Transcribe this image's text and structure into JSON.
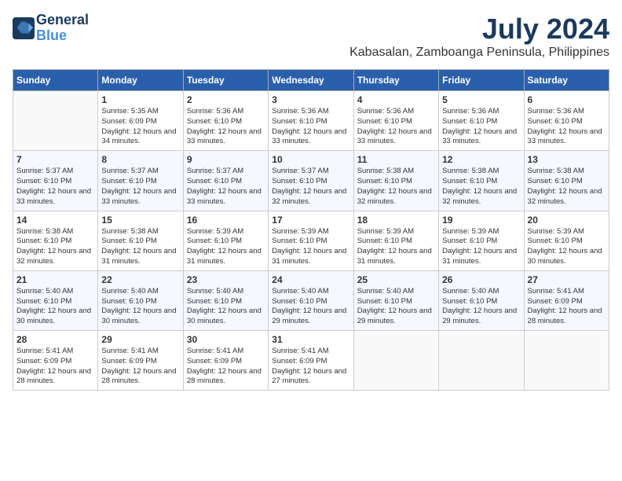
{
  "logo": {
    "line1": "General",
    "line2": "Blue"
  },
  "title": "July 2024",
  "location": "Kabasalan, Zamboanga Peninsula, Philippines",
  "weekdays": [
    "Sunday",
    "Monday",
    "Tuesday",
    "Wednesday",
    "Thursday",
    "Friday",
    "Saturday"
  ],
  "weeks": [
    [
      {
        "day": "",
        "sunrise": "",
        "sunset": "",
        "daylight": ""
      },
      {
        "day": "1",
        "sunrise": "Sunrise: 5:35 AM",
        "sunset": "Sunset: 6:09 PM",
        "daylight": "Daylight: 12 hours and 34 minutes."
      },
      {
        "day": "2",
        "sunrise": "Sunrise: 5:36 AM",
        "sunset": "Sunset: 6:10 PM",
        "daylight": "Daylight: 12 hours and 33 minutes."
      },
      {
        "day": "3",
        "sunrise": "Sunrise: 5:36 AM",
        "sunset": "Sunset: 6:10 PM",
        "daylight": "Daylight: 12 hours and 33 minutes."
      },
      {
        "day": "4",
        "sunrise": "Sunrise: 5:36 AM",
        "sunset": "Sunset: 6:10 PM",
        "daylight": "Daylight: 12 hours and 33 minutes."
      },
      {
        "day": "5",
        "sunrise": "Sunrise: 5:36 AM",
        "sunset": "Sunset: 6:10 PM",
        "daylight": "Daylight: 12 hours and 33 minutes."
      },
      {
        "day": "6",
        "sunrise": "Sunrise: 5:36 AM",
        "sunset": "Sunset: 6:10 PM",
        "daylight": "Daylight: 12 hours and 33 minutes."
      }
    ],
    [
      {
        "day": "7",
        "sunrise": "Sunrise: 5:37 AM",
        "sunset": "Sunset: 6:10 PM",
        "daylight": "Daylight: 12 hours and 33 minutes."
      },
      {
        "day": "8",
        "sunrise": "Sunrise: 5:37 AM",
        "sunset": "Sunset: 6:10 PM",
        "daylight": "Daylight: 12 hours and 33 minutes."
      },
      {
        "day": "9",
        "sunrise": "Sunrise: 5:37 AM",
        "sunset": "Sunset: 6:10 PM",
        "daylight": "Daylight: 12 hours and 33 minutes."
      },
      {
        "day": "10",
        "sunrise": "Sunrise: 5:37 AM",
        "sunset": "Sunset: 6:10 PM",
        "daylight": "Daylight: 12 hours and 32 minutes."
      },
      {
        "day": "11",
        "sunrise": "Sunrise: 5:38 AM",
        "sunset": "Sunset: 6:10 PM",
        "daylight": "Daylight: 12 hours and 32 minutes."
      },
      {
        "day": "12",
        "sunrise": "Sunrise: 5:38 AM",
        "sunset": "Sunset: 6:10 PM",
        "daylight": "Daylight: 12 hours and 32 minutes."
      },
      {
        "day": "13",
        "sunrise": "Sunrise: 5:38 AM",
        "sunset": "Sunset: 6:10 PM",
        "daylight": "Daylight: 12 hours and 32 minutes."
      }
    ],
    [
      {
        "day": "14",
        "sunrise": "Sunrise: 5:38 AM",
        "sunset": "Sunset: 6:10 PM",
        "daylight": "Daylight: 12 hours and 32 minutes."
      },
      {
        "day": "15",
        "sunrise": "Sunrise: 5:38 AM",
        "sunset": "Sunset: 6:10 PM",
        "daylight": "Daylight: 12 hours and 31 minutes."
      },
      {
        "day": "16",
        "sunrise": "Sunrise: 5:39 AM",
        "sunset": "Sunset: 6:10 PM",
        "daylight": "Daylight: 12 hours and 31 minutes."
      },
      {
        "day": "17",
        "sunrise": "Sunrise: 5:39 AM",
        "sunset": "Sunset: 6:10 PM",
        "daylight": "Daylight: 12 hours and 31 minutes."
      },
      {
        "day": "18",
        "sunrise": "Sunrise: 5:39 AM",
        "sunset": "Sunset: 6:10 PM",
        "daylight": "Daylight: 12 hours and 31 minutes."
      },
      {
        "day": "19",
        "sunrise": "Sunrise: 5:39 AM",
        "sunset": "Sunset: 6:10 PM",
        "daylight": "Daylight: 12 hours and 31 minutes."
      },
      {
        "day": "20",
        "sunrise": "Sunrise: 5:39 AM",
        "sunset": "Sunset: 6:10 PM",
        "daylight": "Daylight: 12 hours and 30 minutes."
      }
    ],
    [
      {
        "day": "21",
        "sunrise": "Sunrise: 5:40 AM",
        "sunset": "Sunset: 6:10 PM",
        "daylight": "Daylight: 12 hours and 30 minutes."
      },
      {
        "day": "22",
        "sunrise": "Sunrise: 5:40 AM",
        "sunset": "Sunset: 6:10 PM",
        "daylight": "Daylight: 12 hours and 30 minutes."
      },
      {
        "day": "23",
        "sunrise": "Sunrise: 5:40 AM",
        "sunset": "Sunset: 6:10 PM",
        "daylight": "Daylight: 12 hours and 30 minutes."
      },
      {
        "day": "24",
        "sunrise": "Sunrise: 5:40 AM",
        "sunset": "Sunset: 6:10 PM",
        "daylight": "Daylight: 12 hours and 29 minutes."
      },
      {
        "day": "25",
        "sunrise": "Sunrise: 5:40 AM",
        "sunset": "Sunset: 6:10 PM",
        "daylight": "Daylight: 12 hours and 29 minutes."
      },
      {
        "day": "26",
        "sunrise": "Sunrise: 5:40 AM",
        "sunset": "Sunset: 6:10 PM",
        "daylight": "Daylight: 12 hours and 29 minutes."
      },
      {
        "day": "27",
        "sunrise": "Sunrise: 5:41 AM",
        "sunset": "Sunset: 6:09 PM",
        "daylight": "Daylight: 12 hours and 28 minutes."
      }
    ],
    [
      {
        "day": "28",
        "sunrise": "Sunrise: 5:41 AM",
        "sunset": "Sunset: 6:09 PM",
        "daylight": "Daylight: 12 hours and 28 minutes."
      },
      {
        "day": "29",
        "sunrise": "Sunrise: 5:41 AM",
        "sunset": "Sunset: 6:09 PM",
        "daylight": "Daylight: 12 hours and 28 minutes."
      },
      {
        "day": "30",
        "sunrise": "Sunrise: 5:41 AM",
        "sunset": "Sunset: 6:09 PM",
        "daylight": "Daylight: 12 hours and 28 minutes."
      },
      {
        "day": "31",
        "sunrise": "Sunrise: 5:41 AM",
        "sunset": "Sunset: 6:09 PM",
        "daylight": "Daylight: 12 hours and 27 minutes."
      },
      {
        "day": "",
        "sunrise": "",
        "sunset": "",
        "daylight": ""
      },
      {
        "day": "",
        "sunrise": "",
        "sunset": "",
        "daylight": ""
      },
      {
        "day": "",
        "sunrise": "",
        "sunset": "",
        "daylight": ""
      }
    ]
  ]
}
